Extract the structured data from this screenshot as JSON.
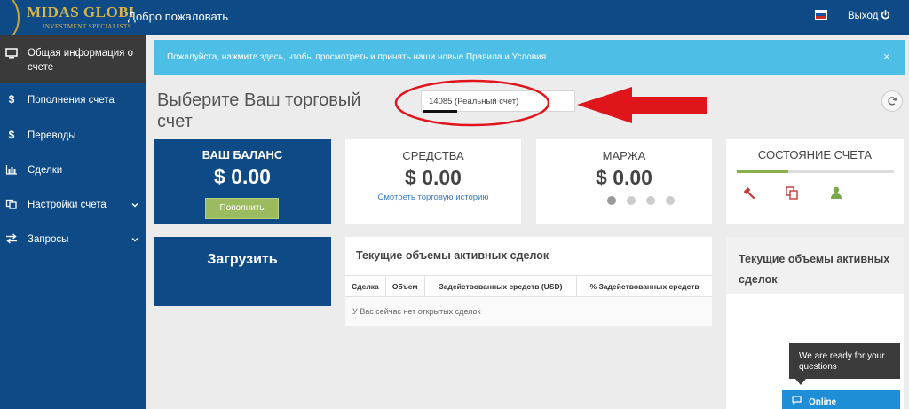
{
  "header": {
    "logo_name": "MIDAS GLOBE",
    "logo_sub": "INVESTMENT SPECIALISTS",
    "welcome": "Добро пожаловать",
    "logout": "Выход"
  },
  "sidebar": {
    "items": [
      {
        "icon": "monitor-icon",
        "label": "Общая информация о счете"
      },
      {
        "icon": "dollar-icon",
        "label": "Пополнения счета"
      },
      {
        "icon": "dollar-icon",
        "label": "Переводы"
      },
      {
        "icon": "bar-chart-icon",
        "label": "Сделки"
      },
      {
        "icon": "copy-icon",
        "label": "Настройки счета"
      },
      {
        "icon": "exchange-icon",
        "label": "Запросы"
      }
    ]
  },
  "alert": {
    "text": "Пожалуйста, нажмите здесь, чтобы просмотреть и принять наши новые Правила и Условия",
    "close": "×"
  },
  "account": {
    "heading": "Выберите Ваш торговый счет",
    "selected": "14085 (Реальный счет)"
  },
  "balance": {
    "title": "ВАШ БАЛАНС",
    "value": "$ 0.00",
    "button": "Пополнить"
  },
  "funds": {
    "title": "СРЕДСТВА",
    "value": "$ 0.00",
    "link": "Смотреть торговую историю"
  },
  "margin": {
    "title": "МАРЖА",
    "value": "$ 0.00",
    "pages": 4,
    "current_page": 1
  },
  "status": {
    "title": "СОСТОЯНИЕ СЧЕТА",
    "progress_fraction": 0.33,
    "progress_color": "#8ab04a"
  },
  "upload": {
    "title": "Загрузить"
  },
  "deals": {
    "title": "Текущие объемы активных сделок",
    "columns": [
      "Сделка",
      "Объем",
      "Задействованных средств (USD)",
      "% Задействованных средств"
    ],
    "empty": "У Вас сейчас нет открытых сделок"
  },
  "right_panel": {
    "title": "Текущие объемы активных сделок"
  },
  "chat": {
    "tooltip": "We are ready for your questions",
    "button": "Online"
  },
  "colors": {
    "primary": "#0e4a86",
    "alert": "#4dbfe6",
    "button_green": "#9cbb5f",
    "annotation_red": "#e0141b",
    "chat_blue": "#1e8fd6"
  }
}
